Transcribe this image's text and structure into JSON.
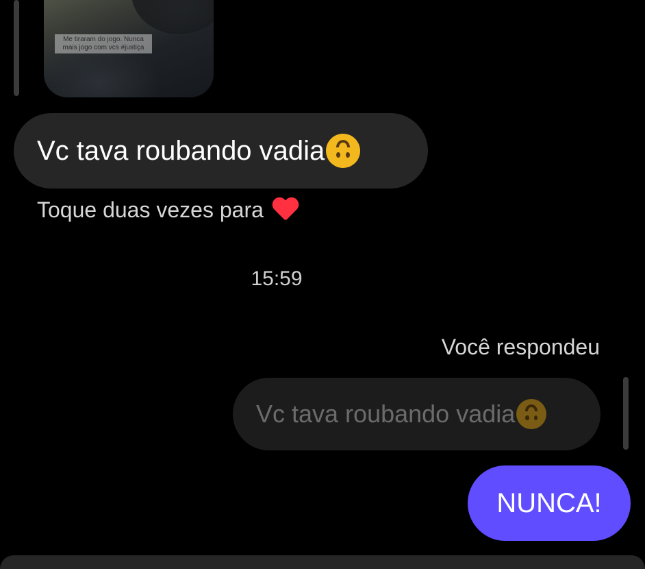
{
  "media": {
    "caption": "Me tiraram do jogo. Nunca mais jogo com vcs #justiça"
  },
  "messages": {
    "received_text": "Vc tava roubando vadia",
    "received_emoji": "upside-down-face-emoji",
    "double_tap_hint": "Toque duas vezes para",
    "hint_icon": "heart-icon",
    "timestamp": "15:59",
    "reply_context": "Você respondeu",
    "quoted_text": "Vc tava roubando vadia",
    "sent_text": "NUNCA!"
  },
  "colors": {
    "background": "#000000",
    "received_bubble": "#262626",
    "sent_bubble": "#5f4dff",
    "heart": "#ff3040"
  }
}
